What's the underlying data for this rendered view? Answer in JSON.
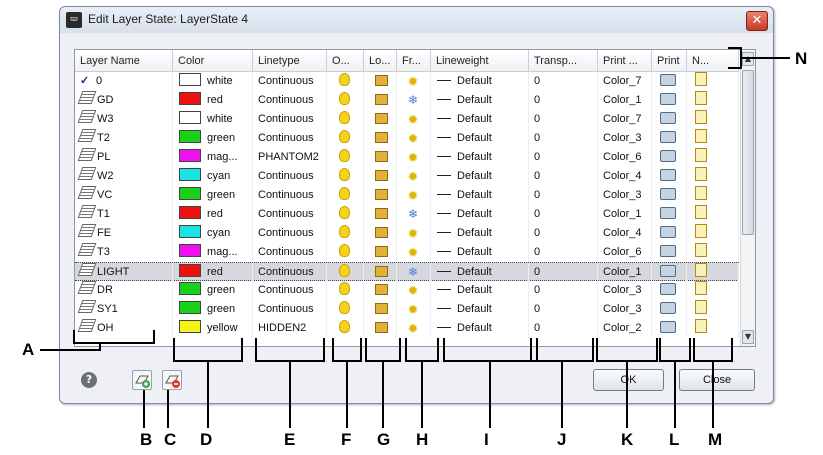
{
  "dialog": {
    "title": "Edit Layer State: LayerState 4",
    "columns": [
      "Layer Name",
      "Color",
      "Linetype",
      "O...",
      "Lo...",
      "Fr...",
      "Lineweight",
      "Transp...",
      "Print ...",
      "Print",
      "N..."
    ],
    "rows": [
      {
        "name": "0",
        "current": true,
        "color_name": "white",
        "color": "#ffffff",
        "linetype": "Continuous",
        "frozen": false,
        "lineweight": "Default",
        "transparency": "0",
        "plot_style": "Color_7"
      },
      {
        "name": "GD",
        "current": false,
        "color_name": "red",
        "color": "#ee1111",
        "linetype": "Continuous",
        "frozen": true,
        "lineweight": "Default",
        "transparency": "0",
        "plot_style": "Color_1"
      },
      {
        "name": "W3",
        "current": false,
        "color_name": "white",
        "color": "#ffffff",
        "linetype": "Continuous",
        "frozen": false,
        "lineweight": "Default",
        "transparency": "0",
        "plot_style": "Color_7"
      },
      {
        "name": "T2",
        "current": false,
        "color_name": "green",
        "color": "#19d119",
        "linetype": "Continuous",
        "frozen": false,
        "lineweight": "Default",
        "transparency": "0",
        "plot_style": "Color_3"
      },
      {
        "name": "PL",
        "current": false,
        "color_name": "mag...",
        "color": "#ee11ee",
        "linetype": "PHANTOM2",
        "frozen": false,
        "lineweight": "Default",
        "transparency": "0",
        "plot_style": "Color_6"
      },
      {
        "name": "W2",
        "current": false,
        "color_name": "cyan",
        "color": "#19e3e3",
        "linetype": "Continuous",
        "frozen": false,
        "lineweight": "Default",
        "transparency": "0",
        "plot_style": "Color_4"
      },
      {
        "name": "VC",
        "current": false,
        "color_name": "green",
        "color": "#19d119",
        "linetype": "Continuous",
        "frozen": false,
        "lineweight": "Default",
        "transparency": "0",
        "plot_style": "Color_3"
      },
      {
        "name": "T1",
        "current": false,
        "color_name": "red",
        "color": "#ee1111",
        "linetype": "Continuous",
        "frozen": true,
        "lineweight": "Default",
        "transparency": "0",
        "plot_style": "Color_1"
      },
      {
        "name": "FE",
        "current": false,
        "color_name": "cyan",
        "color": "#19e3e3",
        "linetype": "Continuous",
        "frozen": false,
        "lineweight": "Default",
        "transparency": "0",
        "plot_style": "Color_4"
      },
      {
        "name": "T3",
        "current": false,
        "color_name": "mag...",
        "color": "#ee11ee",
        "linetype": "Continuous",
        "frozen": false,
        "lineweight": "Default",
        "transparency": "0",
        "plot_style": "Color_6"
      },
      {
        "name": "LIGHT",
        "current": false,
        "selected": true,
        "color_name": "red",
        "color": "#ee1111",
        "linetype": "Continuous",
        "frozen": true,
        "lineweight": "Default",
        "transparency": "0",
        "plot_style": "Color_1"
      },
      {
        "name": "DR",
        "current": false,
        "color_name": "green",
        "color": "#19d119",
        "linetype": "Continuous",
        "frozen": false,
        "lineweight": "Default",
        "transparency": "0",
        "plot_style": "Color_3"
      },
      {
        "name": "SY1",
        "current": false,
        "color_name": "green",
        "color": "#19d119",
        "linetype": "Continuous",
        "frozen": false,
        "lineweight": "Default",
        "transparency": "0",
        "plot_style": "Color_3"
      },
      {
        "name": "OH",
        "current": false,
        "color_name": "yellow",
        "color": "#f5f514",
        "linetype": "HIDDEN2",
        "frozen": false,
        "lineweight": "Default",
        "transparency": "0",
        "plot_style": "Color_2"
      }
    ],
    "ok_label": "OK",
    "close_label": "Close",
    "help_symbol": "?",
    "title_close_symbol": "✕"
  },
  "callouts": {
    "A": "A",
    "B": "B",
    "C": "C",
    "D": "D",
    "E": "E",
    "F": "F",
    "G": "G",
    "H": "H",
    "I": "I",
    "J": "J",
    "K": "K",
    "L": "L",
    "M": "M",
    "N": "N"
  },
  "icons": {
    "title": "dialog-app-icon",
    "help": "help-icon",
    "add_layer": "add-layer-icon",
    "remove_layer": "remove-layer-icon",
    "on": "lightbulb-icon",
    "lock": "lock-icon",
    "freeze": "sun-icon",
    "frozen": "snowflake-icon",
    "plot": "printer-icon",
    "new_vp": "new-viewport-freeze-icon"
  }
}
